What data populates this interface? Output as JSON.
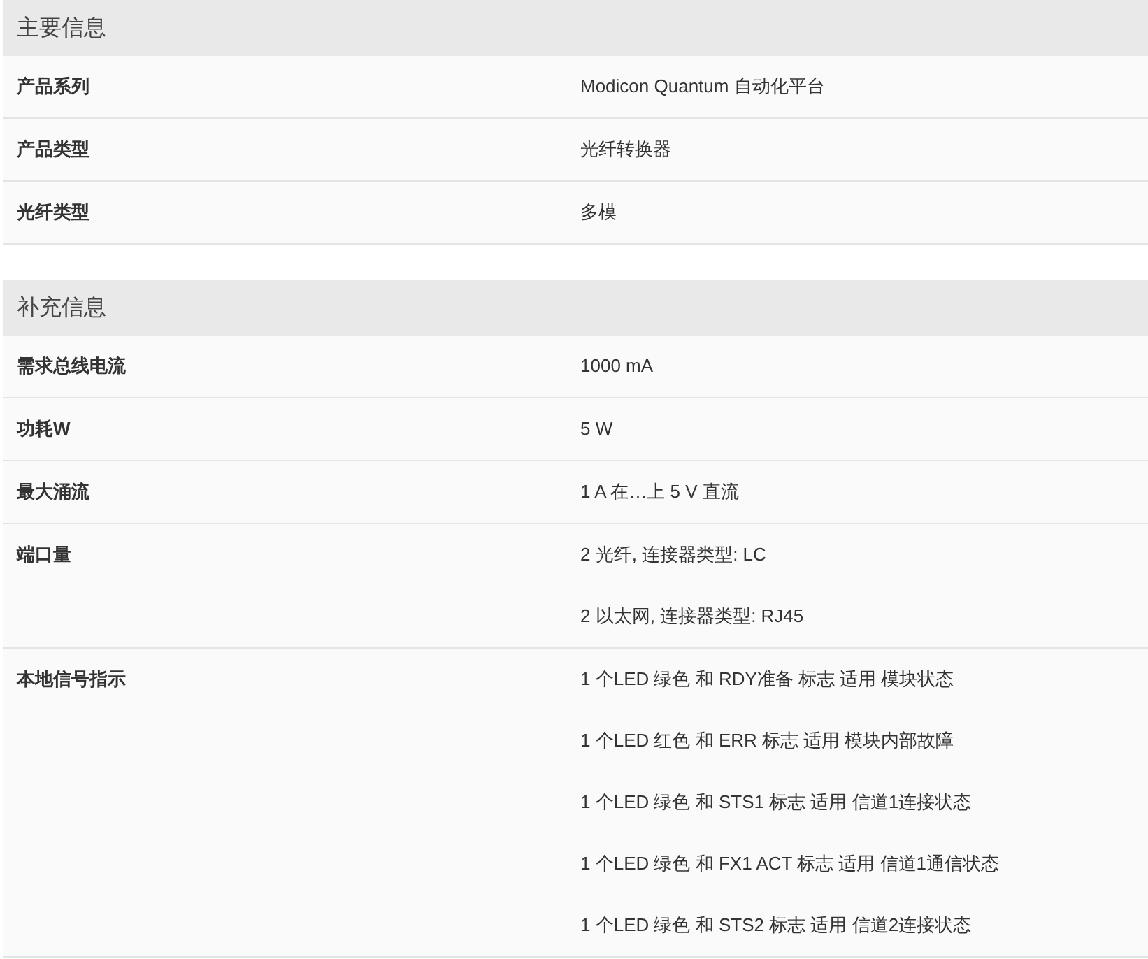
{
  "sections": [
    {
      "title": "主要信息",
      "rows": [
        {
          "label": "产品系列",
          "values": [
            "Modicon Quantum 自动化平台"
          ]
        },
        {
          "label": "产品类型",
          "values": [
            "光纤转换器"
          ]
        },
        {
          "label": "光纤类型",
          "values": [
            "多模"
          ]
        }
      ]
    },
    {
      "title": "补充信息",
      "rows": [
        {
          "label": "需求总线电流",
          "values": [
            "1000 mA"
          ]
        },
        {
          "label": "功耗W",
          "values": [
            "5 W"
          ]
        },
        {
          "label": "最大涌流",
          "values": [
            "1 A 在…上 5 V 直流"
          ]
        },
        {
          "label": "端口量",
          "values": [
            "2 光纤, 连接器类型: LC",
            "2 以太网, 连接器类型: RJ45"
          ]
        },
        {
          "label": "本地信号指示",
          "values": [
            "1 个LED 绿色 和 RDY准备 标志 适用 模块状态",
            "1 个LED 红色 和 ERR 标志 适用 模块内部故障",
            "1 个LED 绿色 和 STS1 标志 适用 信道1连接状态",
            "1 个LED 绿色 和 FX1 ACT 标志 适用 信道1通信状态",
            "1 个LED 绿色 和 STS2 标志 适用 信道2连接状态"
          ]
        }
      ]
    }
  ]
}
